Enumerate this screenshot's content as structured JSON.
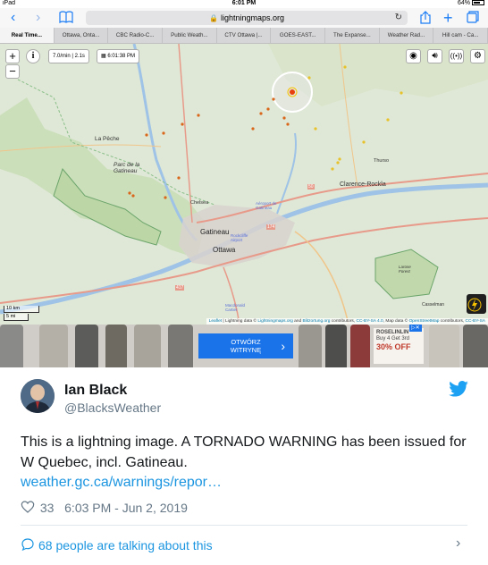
{
  "status_bar": {
    "device": "iPad",
    "time": "6:01 PM",
    "battery": "64%"
  },
  "browser": {
    "url": "lightningmaps.org",
    "lock_icon": "lock-icon",
    "tabs": [
      {
        "label": "Real Time..."
      },
      {
        "label": "Ottawa, Onta..."
      },
      {
        "label": "CBC Radio-C..."
      },
      {
        "label": "Public Weath..."
      },
      {
        "label": "CTV Ottawa |..."
      },
      {
        "label": "GOES-EAST..."
      },
      {
        "label": "The Expanse..."
      },
      {
        "label": "Weather Rad..."
      },
      {
        "label": "Hill cam - Ca..."
      }
    ]
  },
  "map": {
    "rate": "7.0/min | 2.1s",
    "clock": "6:01:38 PM",
    "zoom_in": "+",
    "zoom_out": "−",
    "info": "i",
    "labels": {
      "la_peche": "La Pêche",
      "parc": "Parc de la Gatineau",
      "chelsea": "Chelsea",
      "gatineau": "Gatineau",
      "ottawa": "Ottawa",
      "clarence": "Clarence-Rockla",
      "thurso": "Thurso",
      "rockcliffe": "Rockcliffe Airport",
      "buckingham": "Aéroport de Gatineau",
      "larose": "Larose Forest",
      "casselman": "Casselman",
      "macdonald": "Macdonald Cartier",
      "hwy417": "417",
      "hwy174": "174",
      "hwy50": "50"
    },
    "scale_km": "10 km",
    "scale_mi": "5 mi",
    "attribution": {
      "leaflet": "Leaflet",
      "text1": " | Lightning data © ",
      "lm": "Lightningmaps.org",
      "and": " and ",
      "bo": "Blitzortung.org",
      "text2": " contributors, ",
      "cc1": "CC-BY-SA 4.0",
      "text3": ", Map data © ",
      "osm": "OpenStreetMap",
      "text4": " contributors, ",
      "cc2": "CC-BY-SA"
    }
  },
  "ad": {
    "button_line1": "OTWÓRZ",
    "button_line2": "WITRYNĘ",
    "brand": "ROSELINLIN",
    "promo": "Buy 4 Get 3rd",
    "sale": "30% OFF"
  },
  "tweet": {
    "name": "Ian Black",
    "handle": "@BlacksWeather",
    "text": "This is a lightning image. A TORNADO WARNING has been issued for W Quebec, incl. Gatineau.",
    "link": "weather.gc.ca/warnings/repor…",
    "likes": "33",
    "timestamp": "6:03 PM - Jun 2, 2019",
    "talking": "68 people are talking about this"
  }
}
